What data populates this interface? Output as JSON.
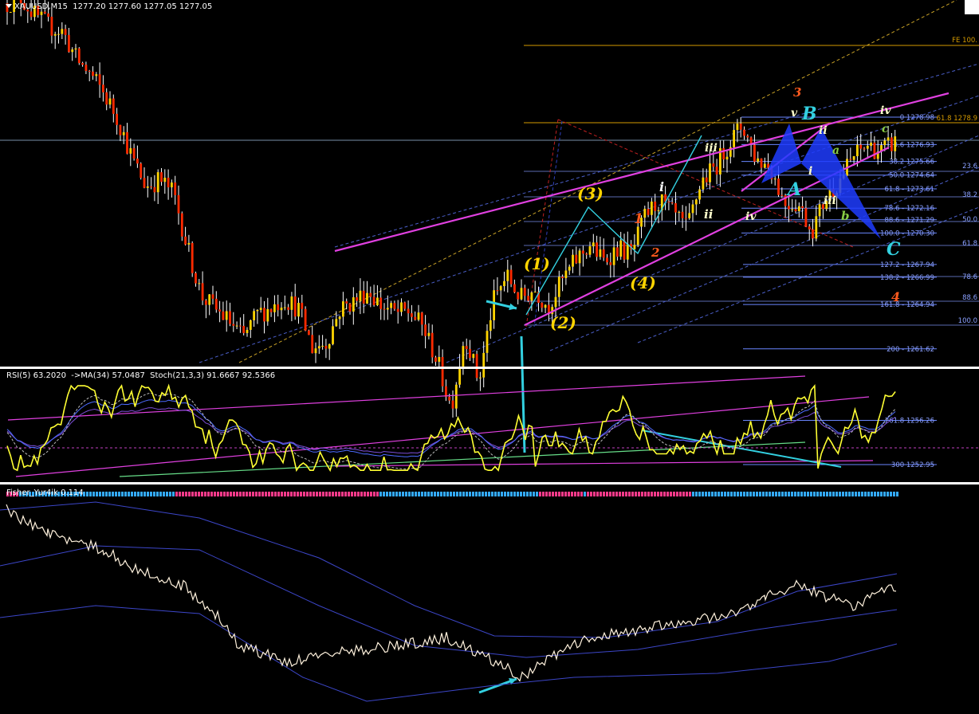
{
  "header": {
    "title": "XAUUSD,M15  1277.20 1277.60 1277.05 1277.05",
    "rsi": "RSI(5) 63.2020  ->MA(34) 57.0487  Stoch(21,3,3) 91.6667 92.5366",
    "fisher": "Fisher_Yur4ik 0.114"
  },
  "colors": {
    "background": "#000000",
    "bull": "#ffd400",
    "bear": "#ff2a00",
    "wick": "#ffffff",
    "trend": "#e040e0",
    "cyan": "#33d0e0",
    "fib": "#6a86ff",
    "fe": "#d49a00",
    "rsi": "#ffff33",
    "stoch_main": "#4d6bff",
    "stoch_signal": "#7a4dd6",
    "fisher": "#fff2dd"
  },
  "chart_data": {
    "type": "candlestick",
    "symbol": "XAUUSD",
    "timeframe": "M15",
    "ohlc": {
      "open": 1277.2,
      "high": 1277.6,
      "low": 1277.05,
      "close": 1277.05
    },
    "price_waypoints": [
      1287.5,
      1287.9,
      1286.6,
      1285.8,
      1285.4,
      1283.3,
      1282.2,
      1280.7,
      1278.8,
      1275.9,
      1273.8,
      1274.3,
      1273.3,
      1269.2,
      1265.6,
      1264.6,
      1263.7,
      1262.4,
      1264.2,
      1264.7,
      1265.4,
      1264.6,
      1261.7,
      1262.1,
      1264.6,
      1265.2,
      1266.0,
      1264.8,
      1264.3,
      1264.4,
      1263.2,
      1260.7,
      1257.2,
      1262.8,
      1259.1,
      1265.1,
      1267.1,
      1265.4,
      1266.1,
      1264.8,
      1266.7,
      1268.3,
      1269.4,
      1268.2,
      1269.2,
      1268.7,
      1271.6,
      1272.7,
      1271.7,
      1270.6,
      1274.1,
      1275.2,
      1277.0,
      1278.4,
      1275.8,
      1275.3,
      1272.6,
      1272.5,
      1270.5,
      1272.9,
      1274.3,
      1276.0,
      1276.9,
      1276.4,
      1277.1
    ],
    "fib_levels": [
      {
        "ratio": "0",
        "price": 1278.98,
        "label": "0 1278.98"
      },
      {
        "ratio": "23.6",
        "price": 1276.93,
        "label": "23.6 1276.93"
      },
      {
        "ratio": "38.2",
        "price": 1275.66,
        "label": "38.2 1275.66"
      },
      {
        "ratio": "50.0",
        "price": 1274.64,
        "label": "50.0 1274.64"
      },
      {
        "ratio": "61.8",
        "price": 1273.61,
        "label": "61.8 - 1273.61"
      },
      {
        "ratio": "78.6",
        "price": 1272.16,
        "label": "78.6 - 1272.16"
      },
      {
        "ratio": "88.6",
        "price": 1271.29,
        "label": "88.6 - 1271.29"
      },
      {
        "ratio": "100.0",
        "price": 1270.3,
        "label": "100.0 - 1270.30"
      },
      {
        "ratio": "127.2",
        "price": 1267.94,
        "label": "127.2 - 1267.94"
      },
      {
        "ratio": "138.2",
        "price": 1266.99,
        "label": "138.2 - 1266.99"
      },
      {
        "ratio": "161.8",
        "price": 1264.94,
        "label": "161.8 - 1264.94"
      },
      {
        "ratio": "200",
        "price": 1261.62,
        "label": "200 - 1261.62"
      },
      {
        "ratio": "261.8",
        "price": 1256.26,
        "label": "261.8 1256.26"
      },
      {
        "ratio": "300",
        "price": 1252.95,
        "label": "300 1252.95"
      }
    ],
    "fe_labels": [
      "FE 100.",
      "61.8 1278.9"
    ],
    "right_scale_labels": [
      "23.6",
      "38.2",
      "50.0",
      "61.8",
      "78.6",
      "88.6",
      "100.0"
    ],
    "wave_labels": [
      {
        "text": "(1)",
        "color": "#ffd400"
      },
      {
        "text": "(2)",
        "color": "#ffd400"
      },
      {
        "text": "(3)",
        "color": "#ffd400"
      },
      {
        "text": "(4)",
        "color": "#ffd400"
      },
      {
        "text": "1",
        "color": "#ff5a1e"
      },
      {
        "text": "2",
        "color": "#ff5a1e"
      },
      {
        "text": "3",
        "color": "#ff5a1e"
      },
      {
        "text": "4",
        "color": "#ff5a1e"
      },
      {
        "text": "i",
        "color": "#ffffff"
      },
      {
        "text": "ii",
        "color": "#ffffcc"
      },
      {
        "text": "iii",
        "color": "#ffffcc"
      },
      {
        "text": "iv",
        "color": "#ffffcc"
      },
      {
        "text": "v",
        "color": "#ffffcc"
      },
      {
        "text": "ii",
        "color": "#ffffcc"
      },
      {
        "text": "i",
        "color": "#ffffcc"
      },
      {
        "text": "iii",
        "color": "#ffffcc"
      },
      {
        "text": "iv",
        "color": "#ffffcc"
      },
      {
        "text": "A",
        "color": "#33d0e0"
      },
      {
        "text": "B",
        "color": "#33d0e0"
      },
      {
        "text": "C",
        "color": "#33d0e0"
      },
      {
        "text": "a",
        "color": "#88cc44"
      },
      {
        "text": "b",
        "color": "#88cc44"
      },
      {
        "text": "c",
        "color": "#88cc44"
      }
    ],
    "rsi": {
      "value": 63.202,
      "ma_period": 34,
      "ma_value": 57.0487
    },
    "stoch": {
      "params": "21,3,3",
      "main": 91.6667,
      "signal": 92.5366
    },
    "fisher": {
      "value": 0.114
    }
  }
}
